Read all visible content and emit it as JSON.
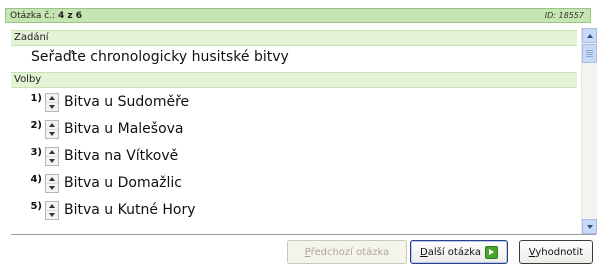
{
  "header": {
    "question_label": "Otázka č.:",
    "question_position": "4 z 6",
    "id_text": "ID: 18557"
  },
  "assignment": {
    "section_title": "Zadání",
    "question_text": "Seřaďte chronologicky husitské bitvy"
  },
  "choices": {
    "section_title": "Volby",
    "items": [
      {
        "number": "1)",
        "label": "Bitva u Sudoměře"
      },
      {
        "number": "2)",
        "label": "Bitva u Malešova"
      },
      {
        "number": "3)",
        "label": "Bitva na Vítkově"
      },
      {
        "number": "4)",
        "label": "Bitva u Domažlic"
      },
      {
        "number": "5)",
        "label": "Bitva u Kutné Hory"
      }
    ]
  },
  "buttons": {
    "previous": {
      "accel": "P",
      "rest": "ředchozí otázka"
    },
    "next": {
      "accel": "D",
      "rest": "alší otázka"
    },
    "evaluate": {
      "accel": "V",
      "rest": "yhodnotit"
    }
  },
  "icons": {
    "spinner": "spinner-up-down-icon",
    "next": "green-arrow-right-icon",
    "scroll_up": "scroll-up-arrow-icon",
    "scroll_down": "scroll-down-arrow-icon"
  },
  "colors": {
    "header_bg": "#c5e6b0",
    "section_bg": "#e4f3d6",
    "next_icon": "#4aa52c",
    "scrollbar_accent": "#c9d9f5"
  }
}
